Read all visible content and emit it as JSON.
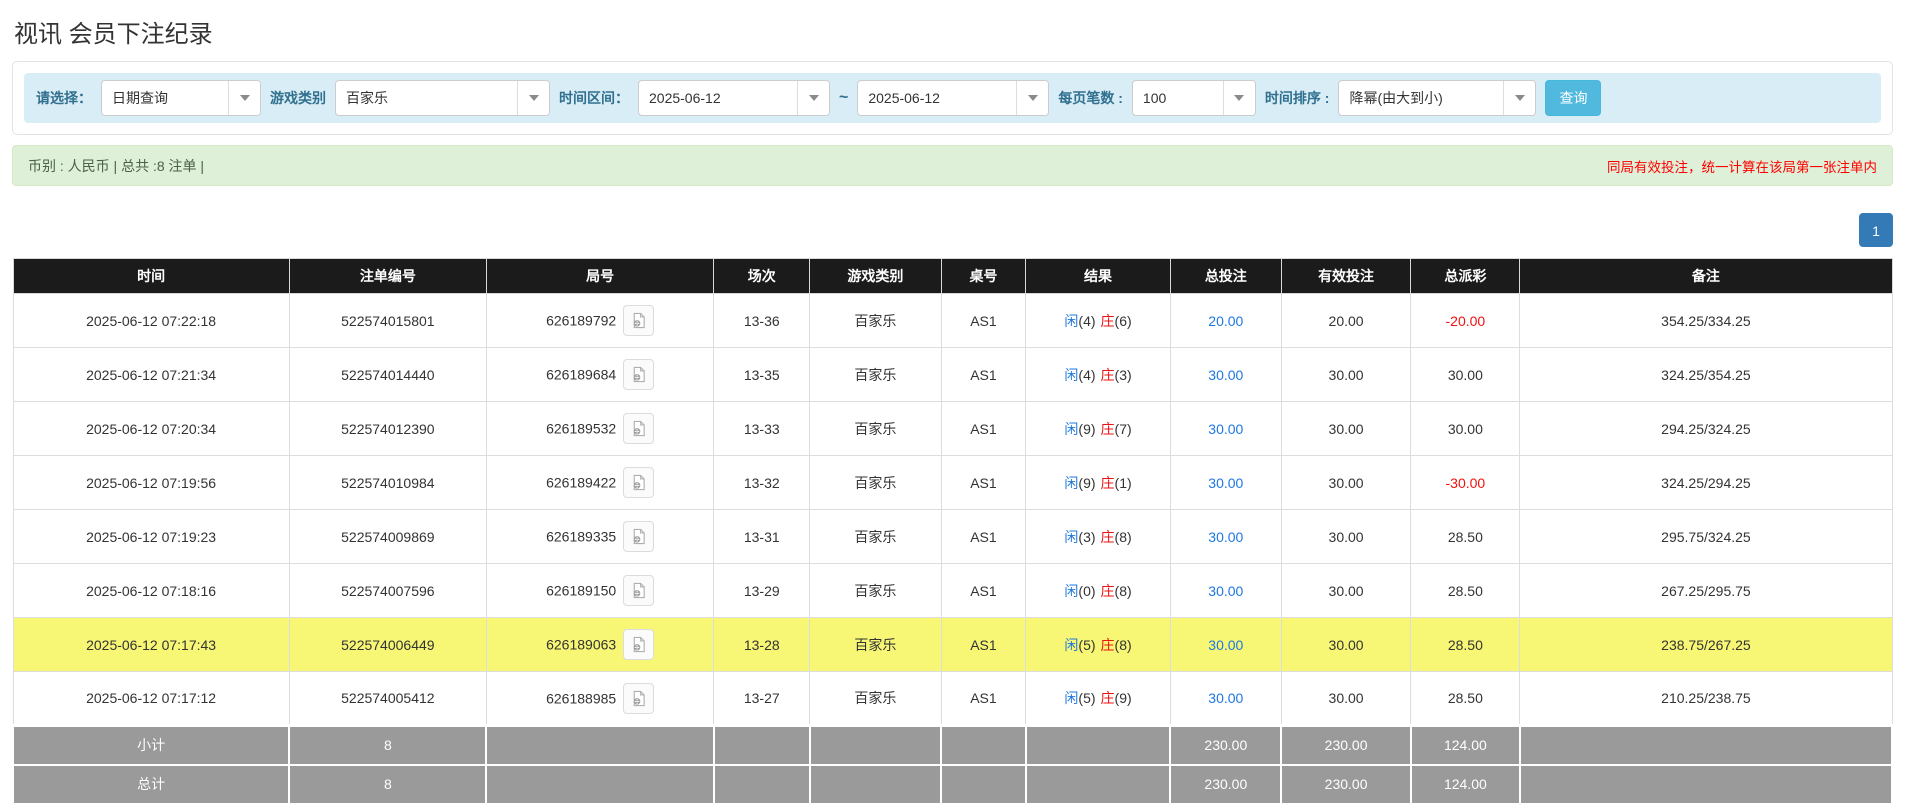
{
  "page": {
    "title": "视讯 会员下注纪录"
  },
  "filters": {
    "select_label": "请选择：",
    "select_value": "日期查询",
    "game_label": "游戏类别",
    "game_value": "百家乐",
    "time_label": "时间区间：",
    "date_from": "2025-06-12",
    "range_separator": "~",
    "date_to": "2025-06-12",
    "per_page_label": "每页笔数 :",
    "per_page_value": "100",
    "sort_label": "时间排序 :",
    "sort_value": "降幂(由大到小)",
    "search_button": "查询"
  },
  "info_bar": {
    "summary": "币别 : 人民币 | 总共 :8 注单 |",
    "notice": "同局有效投注，统一计算在该局第一张注单内"
  },
  "pagination": {
    "current_page": "1"
  },
  "colors": {
    "accent_blue": "#337ab7",
    "filter_bg": "#d9edf7",
    "info_bg": "#dff0d8",
    "highlight_yellow": "#f7f775",
    "negative_red": "#ee1111",
    "value_blue": "#1e78e0"
  },
  "table": {
    "headers": [
      "时间",
      "注单编号",
      "局号",
      "场次",
      "游戏类别",
      "桌号",
      "结果",
      "总投注",
      "有效投注",
      "总派彩",
      "备注"
    ],
    "rows": [
      {
        "time": "2025-06-12 07:22:18",
        "bet_id": "522574015801",
        "round_id": "626189792",
        "session": "13-36",
        "game": "百家乐",
        "table_no": "AS1",
        "result_player": "闲",
        "result_player_score": "(4)",
        "result_banker": "庄",
        "result_banker_score": "(6)",
        "total_bet": "20.00",
        "valid_bet": "20.00",
        "payout": "-20.00",
        "remark": "354.25/334.25",
        "highlighted": false
      },
      {
        "time": "2025-06-12 07:21:34",
        "bet_id": "522574014440",
        "round_id": "626189684",
        "session": "13-35",
        "game": "百家乐",
        "table_no": "AS1",
        "result_player": "闲",
        "result_player_score": "(4)",
        "result_banker": "庄",
        "result_banker_score": "(3)",
        "total_bet": "30.00",
        "valid_bet": "30.00",
        "payout": "30.00",
        "remark": "324.25/354.25",
        "highlighted": false
      },
      {
        "time": "2025-06-12 07:20:34",
        "bet_id": "522574012390",
        "round_id": "626189532",
        "session": "13-33",
        "game": "百家乐",
        "table_no": "AS1",
        "result_player": "闲",
        "result_player_score": "(9)",
        "result_banker": "庄",
        "result_banker_score": "(7)",
        "total_bet": "30.00",
        "valid_bet": "30.00",
        "payout": "30.00",
        "remark": "294.25/324.25",
        "highlighted": false
      },
      {
        "time": "2025-06-12 07:19:56",
        "bet_id": "522574010984",
        "round_id": "626189422",
        "session": "13-32",
        "game": "百家乐",
        "table_no": "AS1",
        "result_player": "闲",
        "result_player_score": "(9)",
        "result_banker": "庄",
        "result_banker_score": "(1)",
        "total_bet": "30.00",
        "valid_bet": "30.00",
        "payout": "-30.00",
        "remark": "324.25/294.25",
        "highlighted": false
      },
      {
        "time": "2025-06-12 07:19:23",
        "bet_id": "522574009869",
        "round_id": "626189335",
        "session": "13-31",
        "game": "百家乐",
        "table_no": "AS1",
        "result_player": "闲",
        "result_player_score": "(3)",
        "result_banker": "庄",
        "result_banker_score": "(8)",
        "total_bet": "30.00",
        "valid_bet": "30.00",
        "payout": "28.50",
        "remark": "295.75/324.25",
        "highlighted": false
      },
      {
        "time": "2025-06-12 07:18:16",
        "bet_id": "522574007596",
        "round_id": "626189150",
        "session": "13-29",
        "game": "百家乐",
        "table_no": "AS1",
        "result_player": "闲",
        "result_player_score": "(0)",
        "result_banker": "庄",
        "result_banker_score": "(8)",
        "total_bet": "30.00",
        "valid_bet": "30.00",
        "payout": "28.50",
        "remark": "267.25/295.75",
        "highlighted": false
      },
      {
        "time": "2025-06-12 07:17:43",
        "bet_id": "522574006449",
        "round_id": "626189063",
        "session": "13-28",
        "game": "百家乐",
        "table_no": "AS1",
        "result_player": "闲",
        "result_player_score": "(5)",
        "result_banker": "庄",
        "result_banker_score": "(8)",
        "total_bet": "30.00",
        "valid_bet": "30.00",
        "payout": "28.50",
        "remark": "238.75/267.25",
        "highlighted": true
      },
      {
        "time": "2025-06-12 07:17:12",
        "bet_id": "522574005412",
        "round_id": "626188985",
        "session": "13-27",
        "game": "百家乐",
        "table_no": "AS1",
        "result_player": "闲",
        "result_player_score": "(5)",
        "result_banker": "庄",
        "result_banker_score": "(9)",
        "total_bet": "30.00",
        "valid_bet": "30.00",
        "payout": "28.50",
        "remark": "210.25/238.75",
        "highlighted": false
      }
    ],
    "footer": [
      {
        "label": "小计",
        "count": "8",
        "total_bet": "230.00",
        "valid_bet": "230.00",
        "payout": "124.00"
      },
      {
        "label": "总计",
        "count": "8",
        "total_bet": "230.00",
        "valid_bet": "230.00",
        "payout": "124.00"
      }
    ]
  }
}
